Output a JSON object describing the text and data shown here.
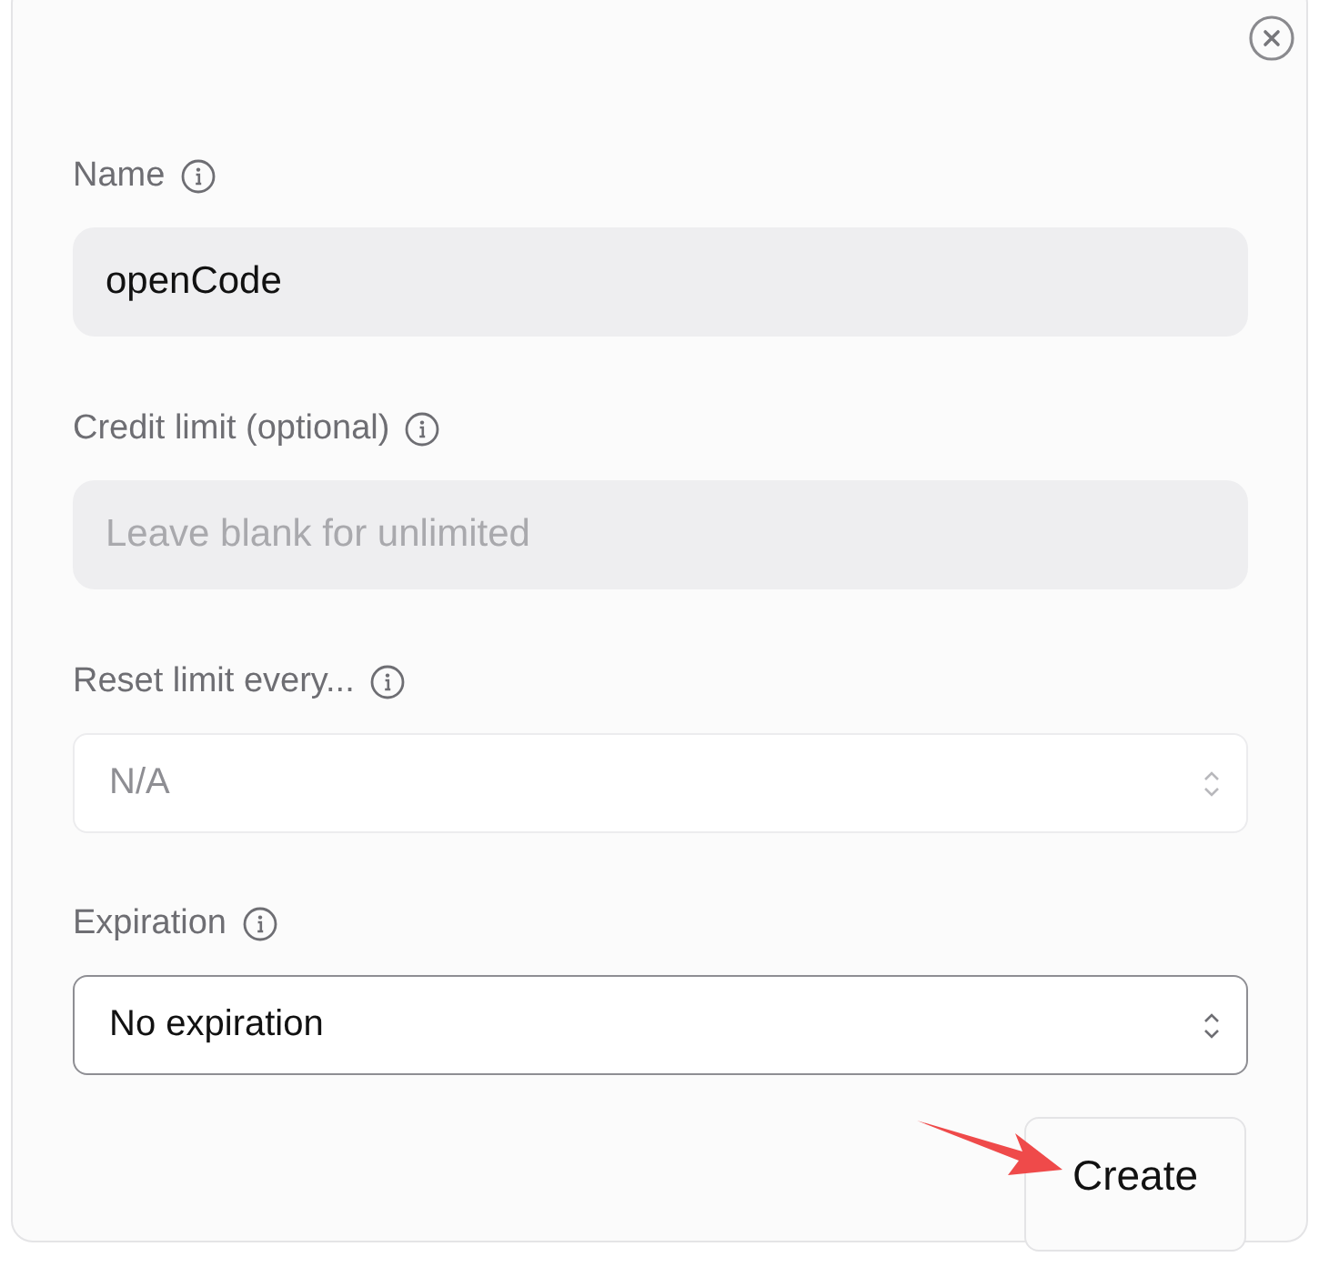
{
  "dialog": {
    "fields": [
      {
        "label": "Name",
        "kind": "text",
        "value": "openCode"
      },
      {
        "label": "Credit limit (optional)",
        "kind": "text",
        "placeholder": "Leave blank for unlimited"
      },
      {
        "label": "Reset limit every...",
        "kind": "select",
        "value": "N/A",
        "disabled": true
      },
      {
        "label": "Expiration",
        "kind": "select",
        "value": "No expiration",
        "disabled": false
      }
    ],
    "submit_button": "Create"
  }
}
